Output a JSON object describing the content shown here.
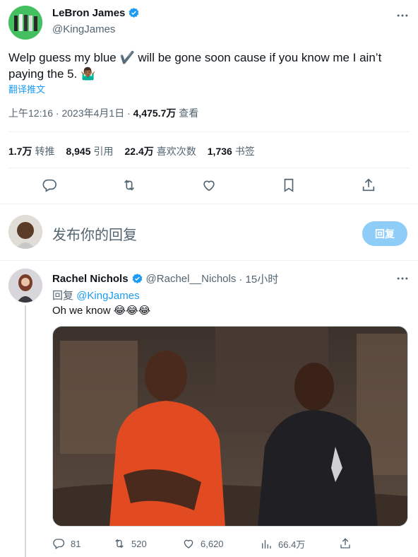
{
  "tweet": {
    "author_name": "LeBron James",
    "author_handle": "@KingJames",
    "text": "Welp guess my blue ✔️ will be gone soon cause if you know me I ain’t paying the 5. 🤷🏾‍♂️",
    "translate_label": "翻译推文",
    "time": "上午12:16 · 2023年4月1日 · ",
    "views_count": "4,475.7万",
    "views_label": "查看",
    "stats": [
      {
        "count": "1.7万",
        "label": "转推"
      },
      {
        "count": "8,945",
        "label": "引用"
      },
      {
        "count": "22.4万",
        "label": "喜欢次数"
      },
      {
        "count": "1,736",
        "label": "书签"
      }
    ]
  },
  "composer": {
    "placeholder": "发布你的回复",
    "button_label": "回复"
  },
  "reply": {
    "author_name": "Rachel Nichols",
    "author_handle": "@Rachel__Nichols",
    "time": "· 15小时",
    "replying_to_prefix": "回复",
    "replying_to_handle": "@KingJames",
    "text": "Oh we know 😂😂😂",
    "counts": {
      "replies": "81",
      "retweets": "520",
      "likes": "6,620",
      "views": "66.4万"
    }
  },
  "colors": {
    "accent": "#1d9bf0",
    "verified": "#1d9bf0",
    "muted": "#536471",
    "reply_button": "#8ecdf8"
  },
  "icons": [
    "more-icon",
    "verified-badge-icon",
    "reply-icon",
    "retweet-icon",
    "like-icon",
    "bookmark-icon",
    "share-icon",
    "views-icon"
  ]
}
